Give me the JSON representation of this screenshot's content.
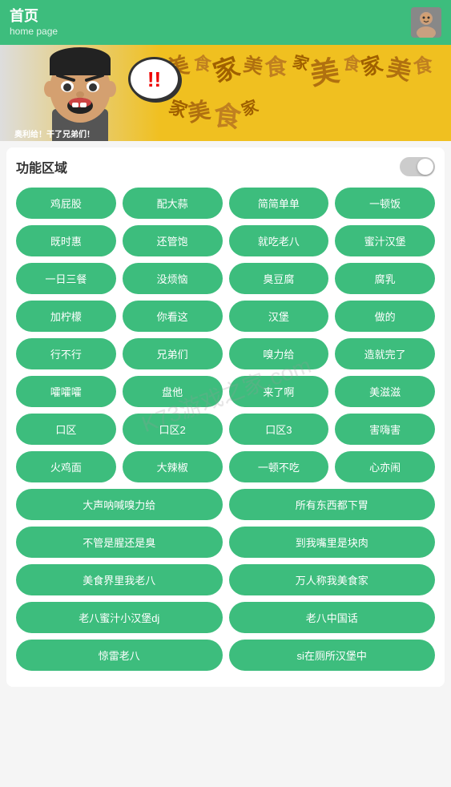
{
  "header": {
    "title": "首页",
    "subtitle": "home page"
  },
  "banner": {
    "caption": "奥利给！干了兄弟们！",
    "exclamation": "!!",
    "words": [
      "美",
      "食",
      "家",
      "美",
      "食",
      "家",
      "美",
      "食",
      "家",
      "美",
      "食",
      "家",
      "美",
      "食",
      "家",
      "美食家",
      "美食家",
      "美食家",
      "美食家",
      "美食家"
    ]
  },
  "feature": {
    "title": "功能区域",
    "buttons_row1": [
      "鸡屁股",
      "配大蒜",
      "简简单单",
      "一顿饭"
    ],
    "buttons_row2": [
      "既时惠",
      "还管饱",
      "就吃老八",
      "蜜汁汉堡"
    ],
    "buttons_row3": [
      "一日三餐",
      "没烦恼",
      "臭豆腐",
      "腐乳"
    ],
    "buttons_row4": [
      "加柠檬",
      "你看这",
      "汉堡",
      "做的"
    ],
    "buttons_row5": [
      "行不行",
      "兄弟们",
      "嗅力给",
      "造就完了"
    ],
    "buttons_row6": [
      "嚯嚯嚯",
      "盘他",
      "来了啊",
      "美滋滋"
    ],
    "buttons_row7": [
      "口区",
      "口区2",
      "口区3",
      "害嗨害"
    ],
    "buttons_row8": [
      "火鸡面",
      "大辣椒",
      "一顿不吃",
      "心亦闹"
    ],
    "buttons_wide_row1": [
      "大声呐喊嗅力给",
      "所有东西都下胃"
    ],
    "buttons_wide_row2": [
      "不管是腥还是臭",
      "到我嘴里是块肉"
    ],
    "buttons_wide_row3": [
      "美食界里我老八",
      "万人称我美食家"
    ],
    "buttons_wide_row4": [
      "老八蜜汁小汉堡dj",
      "老八中国话"
    ],
    "buttons_wide_row5": [
      "惊雷老八",
      "si在厕所汉堡中"
    ]
  },
  "watermark": "K73游戏之家.com"
}
